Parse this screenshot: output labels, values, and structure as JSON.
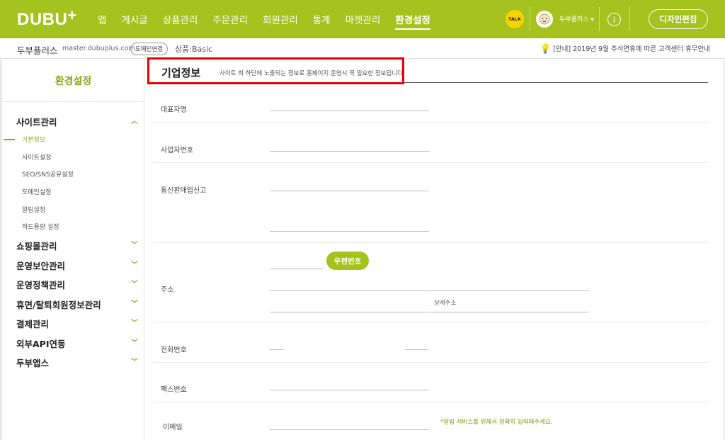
{
  "header": {
    "logo": "DUBU",
    "logo_plus": "+",
    "menu": [
      "앱",
      "게시글",
      "상품관리",
      "주문관리",
      "회원관리",
      "통계",
      "마켓관리",
      "환경설정"
    ],
    "active_menu": "환경설정",
    "talk_label": "TALK",
    "user_name": "두부플러스 ▾",
    "info_label": "i",
    "design_edit": "디자인편집",
    "brand_color": "#a6c21e"
  },
  "subbar": {
    "site_name": "두부플러스",
    "site_url": "master.dubuplus.com",
    "domain_button": "도메인연결",
    "plan": "상품:Basic",
    "notice": "[안내] 2019년 9월 추석연휴에 따른 고객센터 휴무안내"
  },
  "sidebar": {
    "title": "환경설정",
    "groups": [
      {
        "label": "사이트관리",
        "chevron": "^"
      },
      {
        "label": "쇼핑몰관리",
        "chevron": "v"
      },
      {
        "label": "운영보안관리",
        "chevron": "v"
      },
      {
        "label": "운영정책관리",
        "chevron": "v"
      },
      {
        "label": "휴면/탈퇴회원정보관리",
        "chevron": "v"
      },
      {
        "label": "결제관리",
        "chevron": "v"
      },
      {
        "label": "외부API연동",
        "chevron": "v"
      },
      {
        "label": "두부앱스",
        "chevron": "v"
      }
    ],
    "sub_items": [
      "기본정보",
      "사이트설정",
      "SEO/SNS공유설정",
      "도메인설정",
      "알림설정",
      "하드용량 설정"
    ],
    "active_sub": "기본정보"
  },
  "main": {
    "section_title": "기업정보",
    "section_desc": "사이트 최 하단에 노출되는 정보로 홈페이지 운영시 꼭 필요한 정보입니다.",
    "labels": {
      "ceo": "대표자명",
      "biz_no": "사업자번호",
      "mail_order": "통신판매업신고",
      "address": "주소",
      "phone": "전화번호",
      "fax": "팩스번호",
      "email": "이메일"
    },
    "zip_button": "우편번호",
    "detail_address_placeholder": "상세주소",
    "email_hint": "*알림 서비스를 위해서 정확히 입력해주세요."
  }
}
